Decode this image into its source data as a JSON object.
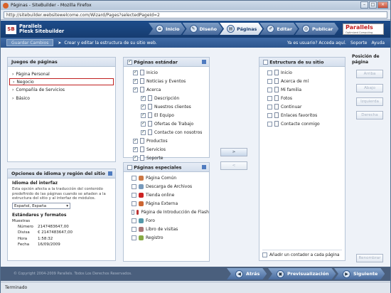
{
  "window": {
    "title": "Páginas - SiteBuilder - Mozilla Firefox",
    "url": "http://sitebuilder.websitewelcome.com/Wizard/Pages?selectedPageId=2"
  },
  "brand": {
    "line1": "Parallels",
    "line2": "Plesk Sitebuilder",
    "logo_box": "SB"
  },
  "steps": [
    {
      "label": "Inicio"
    },
    {
      "label": "Diseño"
    },
    {
      "label": "Páginas"
    },
    {
      "label": "Editar"
    },
    {
      "label": "Publicar"
    }
  ],
  "parallels_logo": {
    "name": "Parallels",
    "tagline": "Optimized Computing"
  },
  "subbar": {
    "save": "Guardar Cambios",
    "description": "Crear y editar la estructura de su sitio web.",
    "user_link": "Ya es usuario? Acceda aquí.",
    "support": "Soporte",
    "help": "Ayuda"
  },
  "page_sets": {
    "title": "Juegos de páginas",
    "items": [
      "Página Personal",
      "Negocio",
      "Compañía de Servicios",
      "Básico"
    ]
  },
  "options": {
    "title": "Opciones de idioma y región del sitio",
    "interface_title": "Idioma del interfaz",
    "interface_desc": "Esta opción afecta a la traducción del contenido predefinido de las páginas cuando se añaden a la estructura del sitio y al interfaz de módulos.",
    "language": "Español, España",
    "standards_title": "Estándares y formatos",
    "samples_label": "Muestras",
    "samples": [
      {
        "k": "Número",
        "v": "2147483647,00"
      },
      {
        "k": "Divisa",
        "v": "€ 2147483647,00"
      },
      {
        "k": "Hora",
        "v": "1:58:32"
      },
      {
        "k": "Fecha",
        "v": "16/09/2009"
      }
    ]
  },
  "standard": {
    "title": "Páginas estándar",
    "items": [
      {
        "label": "Inicio",
        "level": 0,
        "checked": true
      },
      {
        "label": "Noticias y Eventos",
        "level": 0,
        "checked": true
      },
      {
        "label": "Acerca",
        "level": 0,
        "checked": true
      },
      {
        "label": "Descripción",
        "level": 1,
        "checked": true
      },
      {
        "label": "Nuestros clientes",
        "level": 1,
        "checked": true
      },
      {
        "label": "El Equipo",
        "level": 1,
        "checked": true
      },
      {
        "label": "Ofertas de Trabajo",
        "level": 1,
        "checked": true
      },
      {
        "label": "Contacte con nosotros",
        "level": 1,
        "checked": true
      },
      {
        "label": "Productos",
        "level": 0,
        "checked": true
      },
      {
        "label": "Servicios",
        "level": 0,
        "checked": true
      },
      {
        "label": "Soporte",
        "level": 0,
        "checked": true
      }
    ]
  },
  "special": {
    "title": "Páginas especiales",
    "items": [
      "Página Común",
      "Descarga de Archivos",
      "Tienda online",
      "Página Externa",
      "Página de Introducción de Flash",
      "Foro",
      "Libro de visitas",
      "Registro"
    ]
  },
  "move": {
    "add": ">",
    "remove": "<"
  },
  "structure": {
    "title": "Estructura de su sitio",
    "items": [
      "Inicio",
      "Acerca de mí",
      "Mi familia",
      "Fotos",
      "Continuar",
      "Enlaces favoritos",
      "Contacte conmigo"
    ],
    "counter": "Añadir un contador a cada página"
  },
  "position": {
    "title": "Posición de página",
    "buttons": [
      "Arriba",
      "Abajo",
      "Izquierda",
      "Derecha"
    ],
    "rename": "Renombrar"
  },
  "footer": {
    "copyright": "© Copyright 2004-2009 Parallels. Todos Los Derechos Reservados.",
    "back": "Atrás",
    "preview": "Previsualización",
    "next": "Siguiente"
  },
  "status": "Terminado"
}
